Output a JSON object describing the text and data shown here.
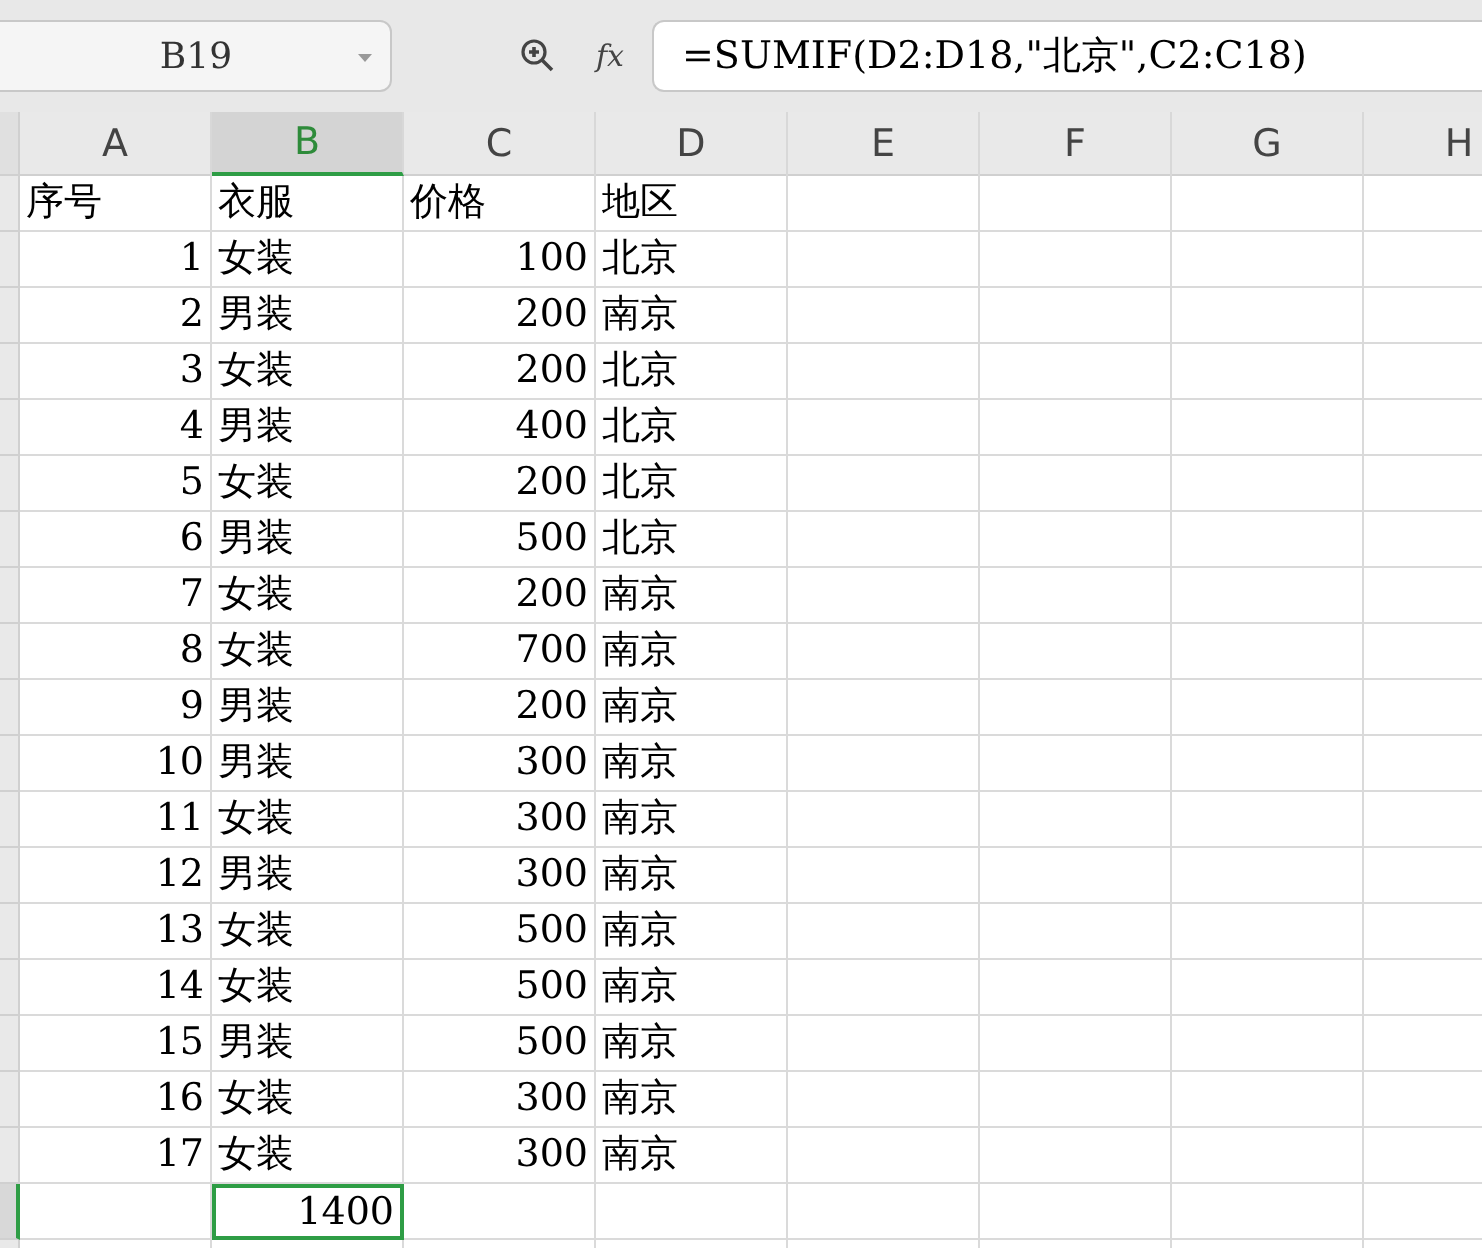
{
  "name_box": {
    "value": "B19"
  },
  "formula_bar": {
    "fx": "fx",
    "value": "=SUMIF(D2:D18,\"北京\",C2:C18)"
  },
  "columns": [
    {
      "label": "A",
      "selected": false
    },
    {
      "label": "B",
      "selected": true
    },
    {
      "label": "C",
      "selected": false
    },
    {
      "label": "D",
      "selected": false
    },
    {
      "label": "E",
      "selected": false
    },
    {
      "label": "F",
      "selected": false
    },
    {
      "label": "G",
      "selected": false
    },
    {
      "label": "H",
      "selected": false
    }
  ],
  "header_row": [
    "序号",
    "衣服",
    "价格",
    "地区"
  ],
  "rows": [
    {
      "no": "1",
      "item": "女装",
      "price": "100",
      "region": "北京"
    },
    {
      "no": "2",
      "item": "男装",
      "price": "200",
      "region": "南京"
    },
    {
      "no": "3",
      "item": "女装",
      "price": "200",
      "region": "北京"
    },
    {
      "no": "4",
      "item": "男装",
      "price": "400",
      "region": "北京"
    },
    {
      "no": "5",
      "item": "女装",
      "price": "200",
      "region": "北京"
    },
    {
      "no": "6",
      "item": "男装",
      "price": "500",
      "region": "北京"
    },
    {
      "no": "7",
      "item": "女装",
      "price": "200",
      "region": "南京"
    },
    {
      "no": "8",
      "item": "女装",
      "price": "700",
      "region": "南京"
    },
    {
      "no": "9",
      "item": "男装",
      "price": "200",
      "region": "南京"
    },
    {
      "no": "10",
      "item": "男装",
      "price": "300",
      "region": "南京"
    },
    {
      "no": "11",
      "item": "女装",
      "price": "300",
      "region": "南京"
    },
    {
      "no": "12",
      "item": "男装",
      "price": "300",
      "region": "南京"
    },
    {
      "no": "13",
      "item": "女装",
      "price": "500",
      "region": "南京"
    },
    {
      "no": "14",
      "item": "女装",
      "price": "500",
      "region": "南京"
    },
    {
      "no": "15",
      "item": "男装",
      "price": "500",
      "region": "南京"
    },
    {
      "no": "16",
      "item": "女装",
      "price": "300",
      "region": "南京"
    },
    {
      "no": "17",
      "item": "女装",
      "price": "300",
      "region": "南京"
    }
  ],
  "result_cell": {
    "value": "1400",
    "selected": true
  }
}
